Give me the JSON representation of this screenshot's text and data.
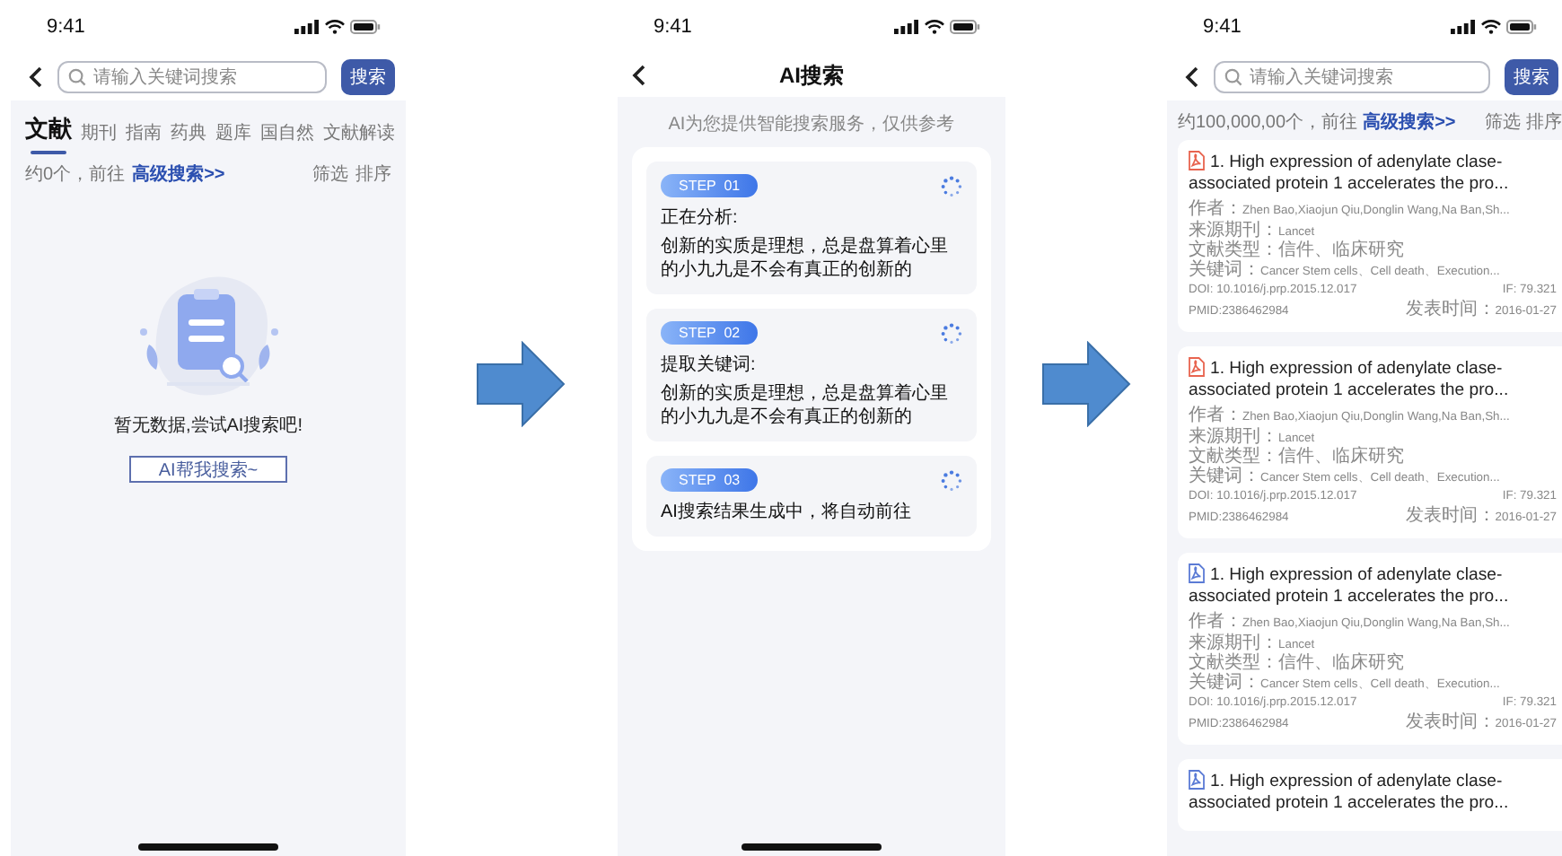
{
  "empty_search_screen": {
    "status_time": "9:41",
    "search": {
      "placeholder": "请输入关键词搜索",
      "button": "搜索"
    },
    "tabs": [
      {
        "label": "文献",
        "selected": true
      },
      {
        "label": "期刊",
        "selected": false
      },
      {
        "label": "指南",
        "selected": false
      },
      {
        "label": "药典",
        "selected": false
      },
      {
        "label": "题库",
        "selected": false
      },
      {
        "label": "国自然",
        "selected": false
      },
      {
        "label": "文献解读",
        "selected": false
      }
    ],
    "summary": {
      "count_text": "约0个，前往",
      "link": "高级搜索>>",
      "filter": "筛选",
      "sort": "排序"
    },
    "empty_message": "暂无数据,尝试AI搜索吧!",
    "ai_button": "AI帮我搜索~"
  },
  "ai_search_screen": {
    "status_time": "9:41",
    "title": "AI搜索",
    "notice": "AI为您提供智能搜索服务，仅供参考",
    "steps": [
      {
        "label": "STEP  01",
        "heading": "正在分析:",
        "text": "创新的实质是理想，总是盘算着心里的小九九是不会有真正的创新的"
      },
      {
        "label": "STEP  02",
        "heading": "提取关键词:",
        "text": "创新的实质是理想，总是盘算着心里的小九九是不会有真正的创新的"
      },
      {
        "label": "STEP  03",
        "text": "AI搜索结果生成中，将自动前往"
      }
    ]
  },
  "results_screen": {
    "status_time": "9:41",
    "search": {
      "placeholder": "请输入关键词搜索",
      "button": "搜索"
    },
    "summary": {
      "count_text": "约100,000,00个，前往",
      "link": "高级搜索>>",
      "filter": "筛选",
      "sort": "排序"
    },
    "results": [
      {
        "color": "#e8644f",
        "title": "1. High expression of adenylate clase-associated protein 1 accelerates the pro...",
        "fields": [
          {
            "label": "作者：",
            "value": "Zhen Bao,Xiaojun Qiu,Donglin Wang,Na Ban,Sh..."
          },
          {
            "label": "来源期刊：",
            "value": "Lancet"
          },
          {
            "label": "文献类型：",
            "value": "信件、临床研究"
          },
          {
            "label": "关键词：",
            "value": "Cancer Stem cells、Cell death、Execution..."
          }
        ],
        "doi": "DOI:  10.1016/j.prp.2015.12.017",
        "impact": "IF:  79.321",
        "pmid": "PMID:2386462984",
        "published": {
          "label": "发表时间：",
          "value": "2016-01-27"
        }
      },
      {
        "color": "#e8644f",
        "title": "1. High expression of adenylate clase-associated protein 1 accelerates the pro...",
        "fields": [
          {
            "label": "作者：",
            "value": "Zhen Bao,Xiaojun Qiu,Donglin Wang,Na Ban,Sh..."
          },
          {
            "label": "来源期刊：",
            "value": "Lancet"
          },
          {
            "label": "文献类型：",
            "value": "信件、临床研究"
          },
          {
            "label": "关键词：",
            "value": "Cancer Stem cells、Cell death、Execution..."
          }
        ],
        "doi": "DOI:  10.1016/j.prp.2015.12.017",
        "impact": "IF:  79.321",
        "pmid": "PMID:2386462984",
        "published": {
          "label": "发表时间：",
          "value": "2016-01-27"
        }
      },
      {
        "color": "#5b7bd5",
        "title": "1. High expression of adenylate clase-associated protein 1 accelerates the pro...",
        "fields": [
          {
            "label": "作者：",
            "value": "Zhen Bao,Xiaojun Qiu,Donglin Wang,Na Ban,Sh..."
          },
          {
            "label": "来源期刊：",
            "value": "Lancet"
          },
          {
            "label": "文献类型：",
            "value": "信件、临床研究"
          },
          {
            "label": "关键词：",
            "value": "Cancer Stem cells、Cell death、Execution..."
          }
        ],
        "doi": "DOI:  10.1016/j.prp.2015.12.017",
        "impact": "IF:  79.321",
        "pmid": "PMID:2386462984",
        "published": {
          "label": "发表时间：",
          "value": "2016-01-27"
        }
      },
      {
        "color": "#5b7bd5",
        "title": "1. High expression of adenylate clase-associated protein 1 accelerates the pro..."
      }
    ]
  }
}
